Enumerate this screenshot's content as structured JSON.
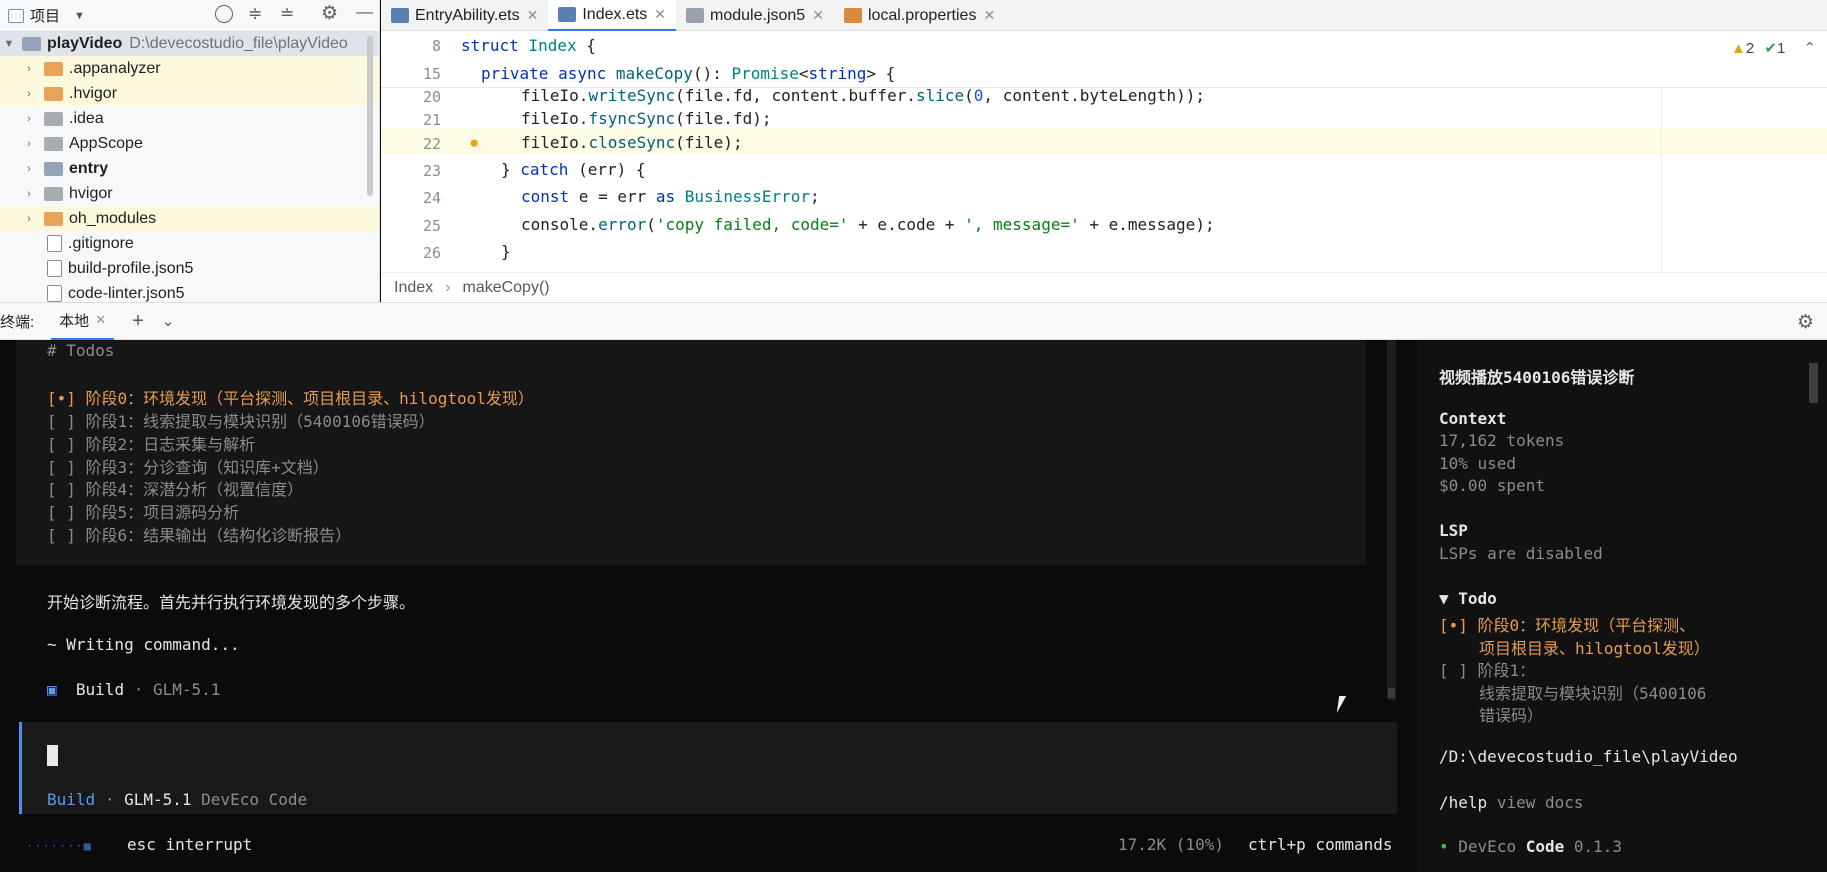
{
  "project_panel": {
    "title": "项目",
    "items": [
      {
        "label": "playVideo",
        "path": "D:\\devecostudio_file\\playVideo"
      },
      {
        "label": ".appanalyzer"
      },
      {
        "label": ".hvigor"
      },
      {
        "label": ".idea"
      },
      {
        "label": "AppScope"
      },
      {
        "label": "entry"
      },
      {
        "label": "hvigor"
      },
      {
        "label": "oh_modules"
      },
      {
        "label": ".gitignore"
      },
      {
        "label": "build-profile.json5"
      },
      {
        "label": "code-linter.json5"
      }
    ]
  },
  "tabs": [
    {
      "label": "EntryAbility.ets"
    },
    {
      "label": "Index.ets"
    },
    {
      "label": "module.json5"
    },
    {
      "label": "local.properties"
    }
  ],
  "editor": {
    "warnings": "2",
    "checks": "1",
    "sticky_lines": [
      {
        "num": "8",
        "text": "struct Index {"
      },
      {
        "num": "15",
        "text": "private async makeCopy(): Promise<string> {"
      }
    ],
    "lines": [
      {
        "num": "20",
        "text": "fileIo.writeSync(file.fd, content.buffer.slice(0, content.byteLength));"
      },
      {
        "num": "21",
        "text": "fileIo.fsyncSync(file.fd);"
      },
      {
        "num": "22",
        "text": "fileIo.closeSync(file);"
      },
      {
        "num": "23",
        "text": "} catch (err) {"
      },
      {
        "num": "24",
        "text": "const e = err as BusinessError;"
      },
      {
        "num": "25",
        "text": "console.error('copy failed, code=' + e.code + ', message=' + e.message);"
      },
      {
        "num": "26",
        "text": "}"
      }
    ],
    "breadcrumb": [
      "Index",
      "makeCopy()"
    ]
  },
  "terminal_bar": {
    "label": "终端:",
    "tab": "本地"
  },
  "terminal": {
    "todos_header": "# Todos",
    "todos": [
      "[•] 阶段0：环境发现（平台探测、项目根目录、hilogtool发现）",
      "[ ] 阶段1：线索提取与模块识别（5400106错误码）",
      "[ ] 阶段2：日志采集与解析",
      "[ ] 阶段3：分诊查询（知识库+文档）",
      "[ ] 阶段4：深潜分析（视置信度）",
      "[ ] 阶段5：项目源码分析",
      "[ ] 阶段6：结果输出（结构化诊断报告）"
    ],
    "message": "开始诊断流程。首先并行执行环境发现的多个步骤。",
    "writing": "~ Writing command...",
    "build_mode": "Build",
    "model": "GLM-5.1",
    "app_name": "DevEco Code",
    "status_left": "esc interrupt",
    "status_tokens": "17.2K (10%)",
    "status_cmd": "ctrl+p commands"
  },
  "sidebar": {
    "title": "视频播放5400106错误诊断",
    "context_label": "Context",
    "tokens": "17,162 tokens",
    "used": "10% used",
    "spent": "$0.00 spent",
    "lsp_label": "LSP",
    "lsp_status": "LSPs are disabled",
    "todo_label": "▼ Todo",
    "todo1_a": "[•] 阶段0：环境发现（平台探测、",
    "todo1_b": "项目根目录、hilogtool发现）",
    "todo2_a": "[ ] 阶段1：",
    "todo2_b": "线索提取与模块识别（5400106",
    "todo2_c": "错误码）",
    "path": "/D:\\devecostudio_file\\playVideo",
    "help_cmd": "/help",
    "help_text": "view docs",
    "version_name": "DevEco Code",
    "version": "0.1.3"
  }
}
